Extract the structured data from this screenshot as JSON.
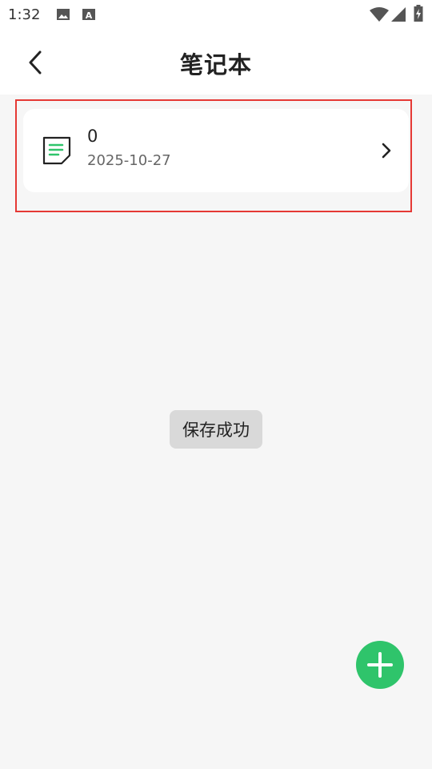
{
  "status_bar": {
    "time": "1:32",
    "icons": [
      "image-icon",
      "a-badge-icon",
      "wifi-icon",
      "signal-icon",
      "battery-icon"
    ]
  },
  "header": {
    "title": "笔记本",
    "back_icon": "chevron-left-icon"
  },
  "notes": [
    {
      "title": "0",
      "date": "2025-10-27",
      "icon": "note-doc-icon",
      "accent_color": "#2fc46b"
    }
  ],
  "toast": {
    "message": "保存成功"
  },
  "fab": {
    "icon": "plus-icon",
    "color": "#2fc46b"
  },
  "highlight_color": "#e53935"
}
